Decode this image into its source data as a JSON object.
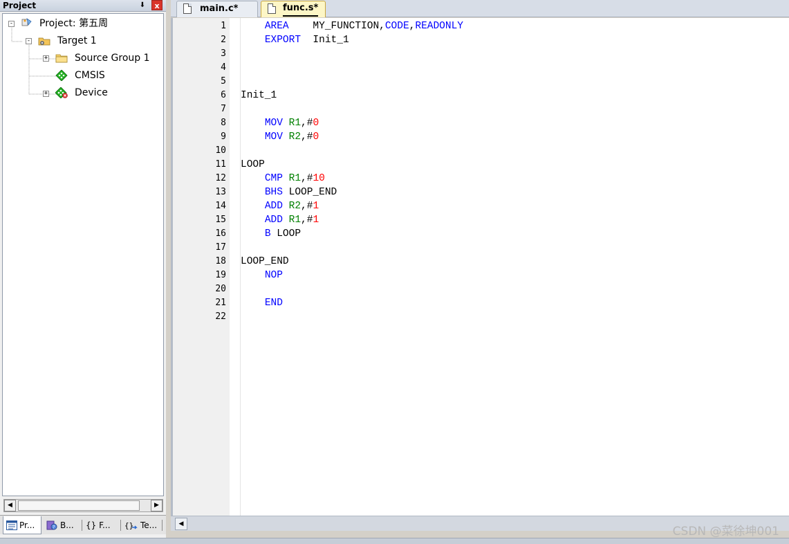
{
  "project_panel": {
    "title": "Project",
    "tree": {
      "project": "Project: 第五周",
      "target": "Target 1",
      "items": [
        "Source Group 1",
        "CMSIS",
        "Device"
      ]
    },
    "tabs": [
      "Pr...",
      "B...",
      "{} F...",
      "Te..."
    ]
  },
  "editor": {
    "tabs": [
      "main.c*",
      "func.s*"
    ],
    "active_tab": "func.s*",
    "line_numbers": [
      "1",
      "2",
      "3",
      "4",
      "5",
      "6",
      "7",
      "8",
      "9",
      "10",
      "11",
      "12",
      "13",
      "14",
      "15",
      "16",
      "17",
      "18",
      "19",
      "20",
      "21",
      "22"
    ],
    "code": {
      "l1_kw": "AREA",
      "l1_mid": "    MY_FUNCTION,",
      "l1_code": "CODE",
      "l1_comma": ",",
      "l1_ro": "READONLY",
      "l2_kw": "EXPORT",
      "l2_rest": "  Init_1",
      "l6": "Init_1",
      "l8_kw": "MOV",
      "l8_reg": "R1",
      "l8_hash": ",#",
      "l8_num": "0",
      "l9_kw": "MOV",
      "l9_reg": "R2",
      "l9_hash": ",#",
      "l9_num": "0",
      "l11": "LOOP",
      "l12_kw": "CMP",
      "l12_reg": "R1",
      "l12_hash": ",#",
      "l12_num": "10",
      "l13_kw": "BHS",
      "l13_rest": " LOOP_END",
      "l14_kw": "ADD",
      "l14_reg": "R2",
      "l14_hash": ",#",
      "l14_num": "1",
      "l15_kw": "ADD",
      "l15_reg": "R1",
      "l15_hash": ",#",
      "l15_num": "1",
      "l16_kw": "B",
      "l16_rest": " LOOP",
      "l18": "LOOP_END",
      "l19_kw": "NOP",
      "l21_kw": "END"
    }
  },
  "watermark": "CSDN @菜徐坤001",
  "colors": {
    "keyword": "#0000ff",
    "register": "#008000",
    "number": "#ff0000",
    "active_tab": "#fdf6c6"
  },
  "icons": [
    "pin-icon",
    "close-icon",
    "project-icon",
    "target-icon",
    "folder-icon",
    "cmsis-icon",
    "device-icon",
    "document-icon"
  ]
}
